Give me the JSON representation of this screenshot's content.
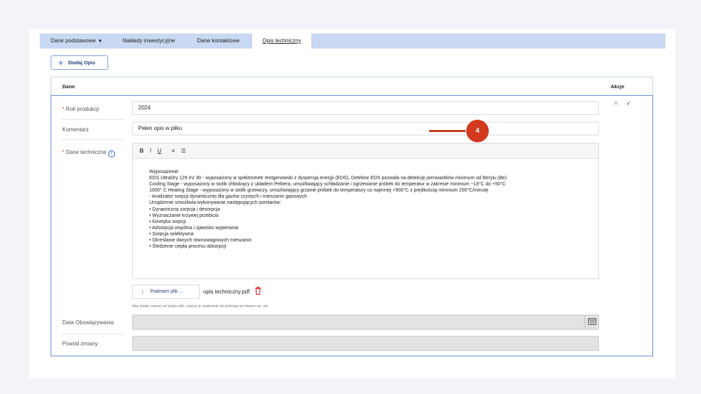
{
  "tabs": [
    {
      "label": "Dane podstawowe",
      "has_dropdown": true
    },
    {
      "label": "Nakłady inwestycyjne"
    },
    {
      "label": "Dane kontaktowe"
    },
    {
      "label": "Opis techniczny",
      "active": true
    }
  ],
  "add_button": {
    "label": "Dodaj Opis",
    "icon": "plus-icon"
  },
  "table": {
    "headers": {
      "data": "Dane",
      "actions": "Akcje"
    }
  },
  "fields": {
    "rok": {
      "label": "Rok produkcji",
      "required": "*",
      "value": "2024"
    },
    "komentarz": {
      "label": "Komentarz",
      "value": "Pełen opis w pliku"
    },
    "dane_techniczne": {
      "label": "Dane techniczne",
      "required": "*",
      "info_icon": "i"
    },
    "data_obowiazywania": {
      "label": "Data Obowiązywania",
      "value": ""
    },
    "powod_zmiany": {
      "label": "Powód zmiany",
      "value": ""
    }
  },
  "editor": {
    "toolbar": {
      "bold": "B",
      "italic": "I",
      "underline": "U",
      "ordered_list": "≡",
      "bullet_list": "☰"
    },
    "lines": [
      "Wyposażenie:",
      "EDS UltraDry 129 eV 30 - wyposażony w spektrometr rentgenowski z dyspersją energii (EDS), Detektor EDS pozwala na detekcję pierwiastków minimum od Berylu (Be)",
      "Cooling Stage - wyposażony w stolik chłodzący z układem Peltiera, umożliwiający schładzanie i ogrzewanie próbek do temperatur w zakresie minimum −18°C do +50°C",
      "1000° C Heating Stage - wyposażony w stolik grzewczy, umożliwiający grzanie próbek do temperatury co najmniej +900°C z prędkością minimum 200°C/minutę",
      "- Analizator sorpcji dynamicznej dla gazów czystych i mieszanin gazowych",
      "Urządzenie umożliwia wykonywanie następujących pomiarów:",
      "• Dynamiczna sorpcja i desorpcja",
      "• Wyznaczanie krzywej przebicia",
      "• Kinetyka sorpcji",
      "• Adsorpcja wspólna i zjawisko wypierania",
      "• Sorpcja selektywna",
      "• Określanie danych równowagowych mieszanin",
      "• Śledzenie ciepła procesu adsorpcji"
    ]
  },
  "upload": {
    "button_label": "Podmień plik ...",
    "filename": "opis techniczny.pdf",
    "hint": "Aby dodać więcej niż jeden plik, należy je spakować do jednego archiwum np. zip"
  },
  "actions": {
    "cancel": "✕",
    "confirm": "✓"
  },
  "annotation": {
    "number": "4",
    "color": "#d33a1f"
  },
  "colors": {
    "tabbar": "#c9d8f3",
    "accent": "#2a5ab8",
    "required": "#d33333"
  }
}
